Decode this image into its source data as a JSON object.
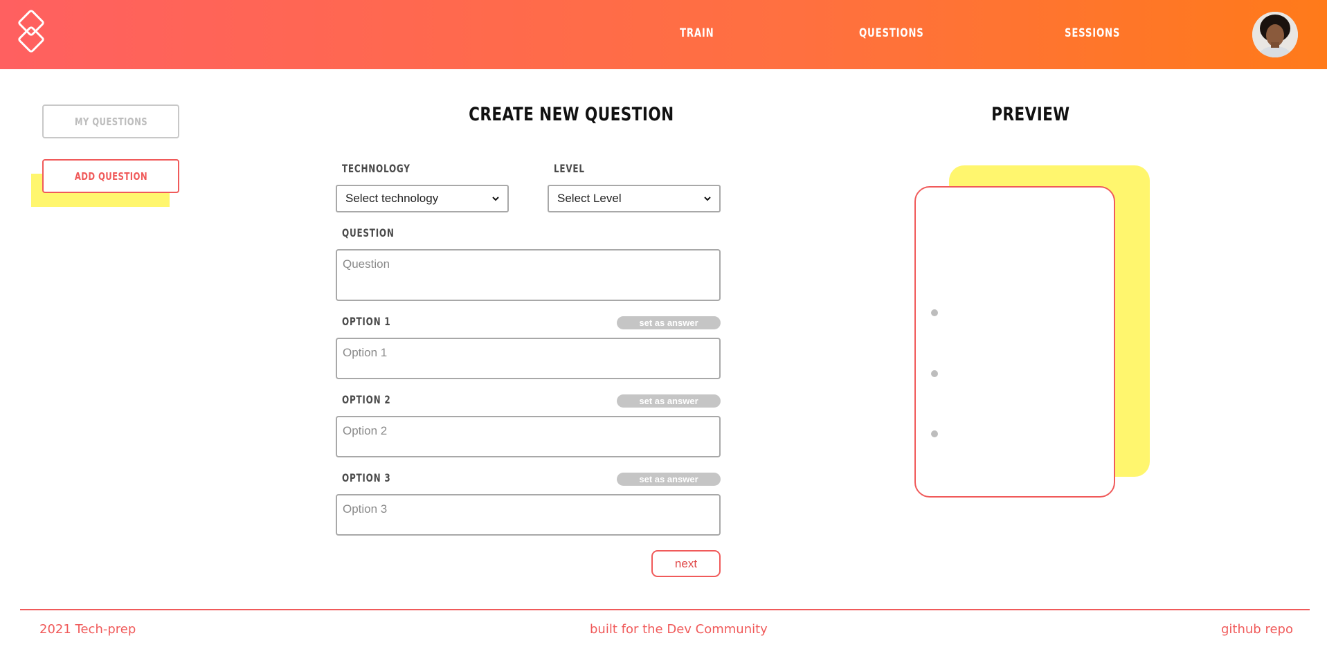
{
  "header": {
    "nav": [
      {
        "label": "TRAIN"
      },
      {
        "label": "QUESTIONS"
      },
      {
        "label": "SESSIONS"
      }
    ],
    "logo_icon": "diamond-logo-icon",
    "avatar_icon": "user-avatar"
  },
  "sidebar": {
    "my_questions_label": "MY QUESTIONS",
    "add_question_label": "ADD QUESTION"
  },
  "form": {
    "title": "CREATE NEW QUESTION",
    "technology_label": "TECHNOLOGY",
    "technology_value": "Select technology",
    "level_label": "LEVEL",
    "level_value": "Select Level",
    "question_label": "QUESTION",
    "question_placeholder": "Question",
    "options": [
      {
        "label": "OPTION 1",
        "placeholder": "Option 1",
        "answer_button": "set as answer"
      },
      {
        "label": "OPTION 2",
        "placeholder": "Option 2",
        "answer_button": "set as answer"
      },
      {
        "label": "OPTION 3",
        "placeholder": "Option 3",
        "answer_button": "set as answer"
      }
    ],
    "next_label": "next"
  },
  "preview": {
    "title": "PREVIEW"
  },
  "footer": {
    "copyright": "2021 Tech-prep",
    "tagline": "built for the Dev Community",
    "repo_link": "github repo"
  },
  "colors": {
    "header_gradient_start": "#ff6060",
    "header_gradient_end": "#ff7a1a",
    "accent_red": "#f05a5a",
    "accent_yellow": "#fff66e",
    "muted_grey": "#c5c5c5"
  }
}
